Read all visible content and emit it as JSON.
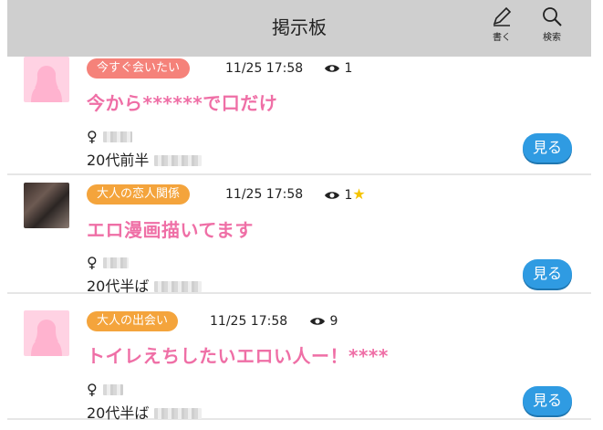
{
  "header": {
    "title": "掲示板",
    "write_label": "書く",
    "search_label": "検索",
    "background": "#cfcfcf"
  },
  "colors": {
    "title_pink": "#ef6fa6",
    "tag_red": "#f5827a",
    "tag_orange": "#f4a43c",
    "button_blue": "#2f9be2",
    "placeholder_pink": "#ffd2e3"
  },
  "posts": [
    {
      "avatar": "placeholder-silhouette",
      "category": "今すぐ会いたい",
      "time": "11/25 17:58",
      "views": "1",
      "starred": false,
      "title": "今から******で口だけ",
      "gender": "♀",
      "age": "20代前半",
      "button": "見る"
    },
    {
      "avatar": "photo",
      "category": "大人の恋人関係",
      "time": "11/25 17:58",
      "views": "1",
      "starred": true,
      "title": "エロ漫画描いてます",
      "gender": "♀",
      "age": "20代半ば",
      "button": "見る"
    },
    {
      "avatar": "placeholder-silhouette",
      "category": "大人の出会い",
      "time": "11/25 17:58",
      "views": "9",
      "starred": false,
      "title": "トイレえちしたいエロい人ー！****",
      "gender": "♀",
      "age": "20代半ば",
      "button": "見る"
    }
  ]
}
